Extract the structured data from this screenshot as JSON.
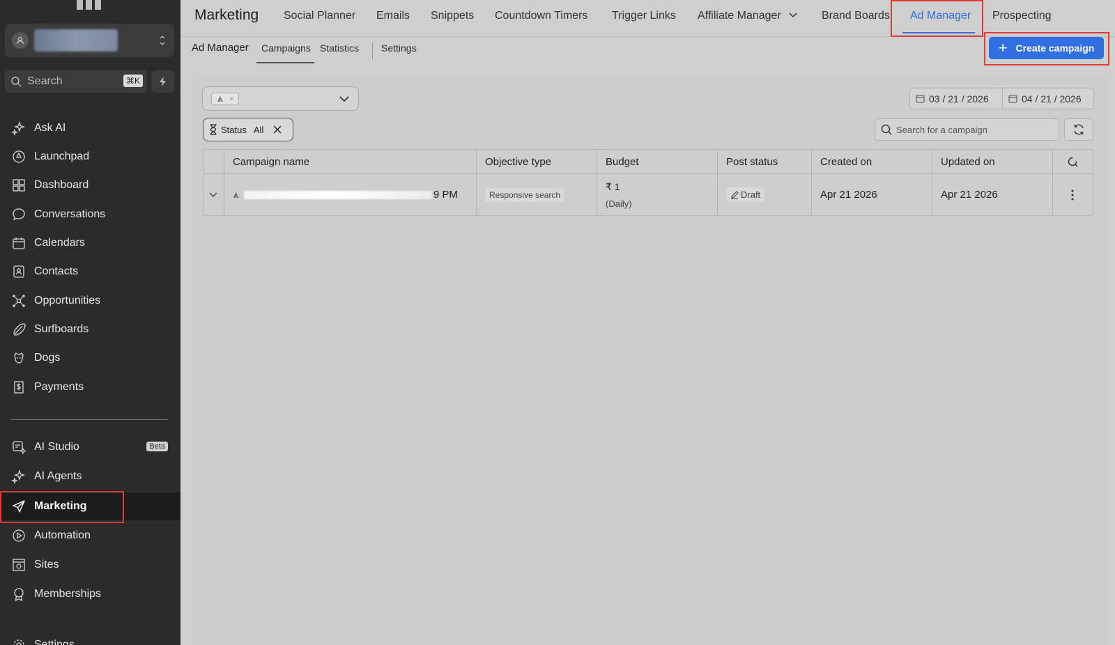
{
  "sidebar": {
    "search_placeholder": "Search",
    "search_shortcut": "⌘K",
    "items": [
      {
        "label": "Ask AI",
        "icon": "sparkle-icon"
      },
      {
        "label": "Launchpad",
        "icon": "rocket-icon"
      },
      {
        "label": "Dashboard",
        "icon": "grid-icon"
      },
      {
        "label": "Conversations",
        "icon": "chat-icon"
      },
      {
        "label": "Calendars",
        "icon": "calendar-icon"
      },
      {
        "label": "Contacts",
        "icon": "contacts-icon"
      },
      {
        "label": "Opportunities",
        "icon": "network-icon"
      },
      {
        "label": "Surfboards",
        "icon": "surfboard-icon"
      },
      {
        "label": "Dogs",
        "icon": "dog-icon"
      },
      {
        "label": "Payments",
        "icon": "dollar-icon"
      }
    ],
    "items2": [
      {
        "label": "AI Studio",
        "icon": "studio-icon",
        "badge": "Beta"
      },
      {
        "label": "AI Agents",
        "icon": "sparkle-icon"
      },
      {
        "label": "Marketing",
        "icon": "send-icon"
      },
      {
        "label": "Automation",
        "icon": "automation-icon"
      },
      {
        "label": "Sites",
        "icon": "sites-icon"
      },
      {
        "label": "Memberships",
        "icon": "badge-icon"
      },
      {
        "label": "Settings",
        "icon": "gear-icon"
      }
    ]
  },
  "topnav": {
    "title": "Marketing",
    "tabs": [
      "Social Planner",
      "Emails",
      "Snippets",
      "Countdown Timers",
      "Trigger Links",
      "Affiliate Manager",
      "Brand Boards",
      "Ad Manager",
      "Prospecting"
    ]
  },
  "subnav": {
    "title": "Ad Manager",
    "tabs": [
      "Campaigns",
      "Statistics",
      "Settings"
    ],
    "create_label": "Create campaign"
  },
  "filters": {
    "date_from": "03 / 21 / 2026",
    "date_to": "04 / 21 / 2026",
    "status_label": "Status",
    "status_value": "All",
    "search_placeholder": "Search for a campaign"
  },
  "table": {
    "headers": [
      "Campaign name",
      "Objective type",
      "Budget",
      "Post status",
      "Created on",
      "Updated on"
    ],
    "rows": [
      {
        "name_suffix": "9 PM",
        "objective": "Responsive search",
        "budget": "₹ 1",
        "budget_period": "(Daily)",
        "post_status": "Draft",
        "created": "Apr 21 2026",
        "updated": "Apr 21 2026"
      }
    ]
  },
  "colors": {
    "accent": "#2f6fe0",
    "highlight": "#e53935",
    "sidebar": "#2b2b2b"
  }
}
